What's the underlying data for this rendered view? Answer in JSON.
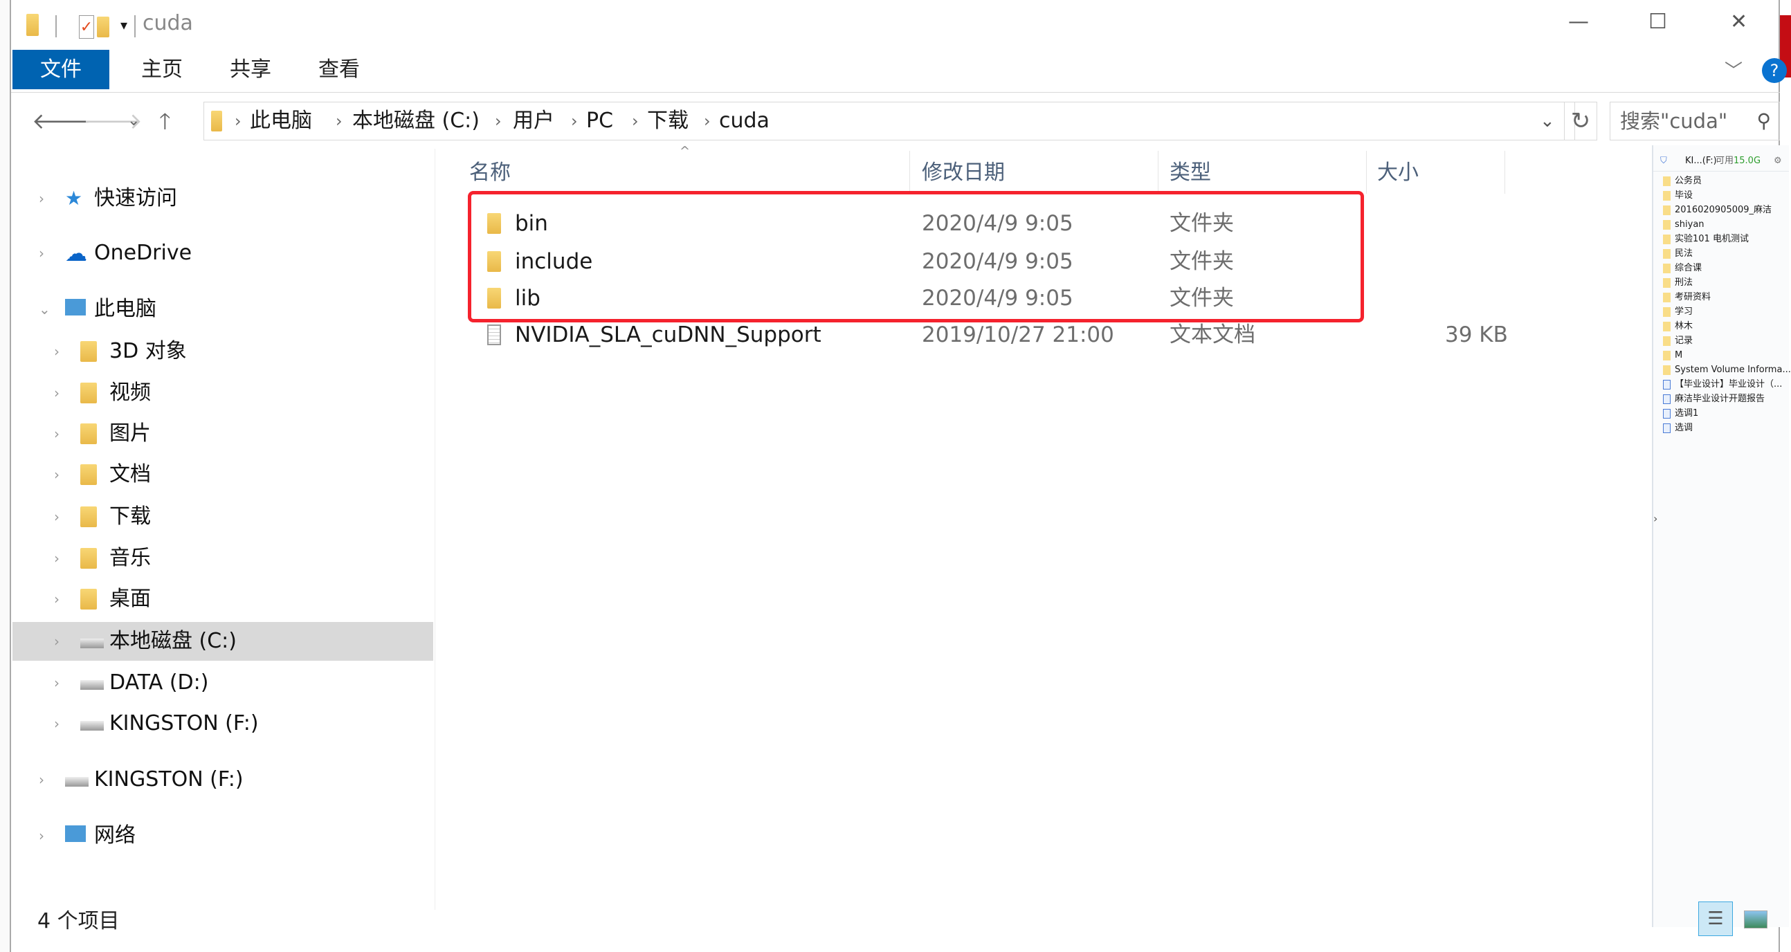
{
  "window": {
    "title": "cuda",
    "controls": {
      "minimize": "—",
      "maximize": "☐",
      "close": "✕"
    }
  },
  "ribbon": {
    "tabs": [
      {
        "label": "文件",
        "active": true
      },
      {
        "label": "主页"
      },
      {
        "label": "共享"
      },
      {
        "label": "查看"
      }
    ],
    "help": "?"
  },
  "address": {
    "crumbs": [
      "此电脑",
      "本地磁盘 (C:)",
      "用户",
      "PC",
      "下载",
      "cuda"
    ]
  },
  "search": {
    "placeholder": "搜索\"cuda\""
  },
  "sidebar": {
    "items": [
      {
        "label": "快速访问",
        "icon": "star-icon"
      },
      {
        "label": "OneDrive",
        "icon": "cloud-icon"
      },
      {
        "label": "此电脑",
        "icon": "computer-icon"
      },
      {
        "label": "3D 对象",
        "icon": "folder-3d-icon"
      },
      {
        "label": "视频",
        "icon": "folder-video-icon"
      },
      {
        "label": "图片",
        "icon": "folder-pictures-icon"
      },
      {
        "label": "文档",
        "icon": "folder-documents-icon"
      },
      {
        "label": "下载",
        "icon": "folder-downloads-icon"
      },
      {
        "label": "音乐",
        "icon": "folder-music-icon"
      },
      {
        "label": "桌面",
        "icon": "folder-desktop-icon"
      },
      {
        "label": "本地磁盘 (C:)",
        "icon": "drive-icon",
        "selected": true
      },
      {
        "label": "DATA (D:)",
        "icon": "drive-icon"
      },
      {
        "label": "KINGSTON (F:)",
        "icon": "usb-drive-icon"
      },
      {
        "label": "KINGSTON (F:)",
        "icon": "usb-drive-icon"
      },
      {
        "label": "网络",
        "icon": "network-icon"
      }
    ]
  },
  "columns": {
    "name": "名称",
    "date": "修改日期",
    "type": "类型",
    "size": "大小"
  },
  "files": [
    {
      "name": "bin",
      "date": "2020/4/9 9:05",
      "type": "文件夹",
      "size": "",
      "icon": "folder-icon"
    },
    {
      "name": "include",
      "date": "2020/4/9 9:05",
      "type": "文件夹",
      "size": "",
      "icon": "folder-icon"
    },
    {
      "name": "lib",
      "date": "2020/4/9 9:05",
      "type": "文件夹",
      "size": "",
      "icon": "folder-icon"
    },
    {
      "name": "NVIDIA_SLA_cuDNN_Support",
      "date": "2019/10/27 21:00",
      "type": "文本文档",
      "size": "39 KB",
      "icon": "text-file-icon"
    }
  ],
  "status": {
    "count": "4 个项目"
  },
  "usb_panel": {
    "drive": "KI...(F:)",
    "free_label": "可用",
    "free": "15.0G",
    "free_color": "#2e9e2e",
    "items": [
      {
        "label": "公务员",
        "kind": "folder"
      },
      {
        "label": "毕设",
        "kind": "folder"
      },
      {
        "label": "2016020905009_麻洁",
        "kind": "folder"
      },
      {
        "label": "shiyan",
        "kind": "folder"
      },
      {
        "label": "实验101 电机测试",
        "kind": "folder"
      },
      {
        "label": "民法",
        "kind": "folder"
      },
      {
        "label": "综合课",
        "kind": "folder"
      },
      {
        "label": "刑法",
        "kind": "folder"
      },
      {
        "label": "考研资料",
        "kind": "folder"
      },
      {
        "label": "学习",
        "kind": "folder"
      },
      {
        "label": "林木",
        "kind": "folder"
      },
      {
        "label": "记录",
        "kind": "folder"
      },
      {
        "label": "M",
        "kind": "folder"
      },
      {
        "label": "System Volume Informa...",
        "kind": "folder"
      },
      {
        "label": "【毕业设计】毕业设计（...",
        "kind": "doc"
      },
      {
        "label": "麻洁毕业设计开题报告",
        "kind": "doc"
      },
      {
        "label": "选调1",
        "kind": "doc"
      },
      {
        "label": "选调",
        "kind": "doc"
      }
    ]
  },
  "colors": {
    "accent": "#0063b1",
    "highlight_box": "#f5222d",
    "selected_bg": "#d9d9d9"
  }
}
